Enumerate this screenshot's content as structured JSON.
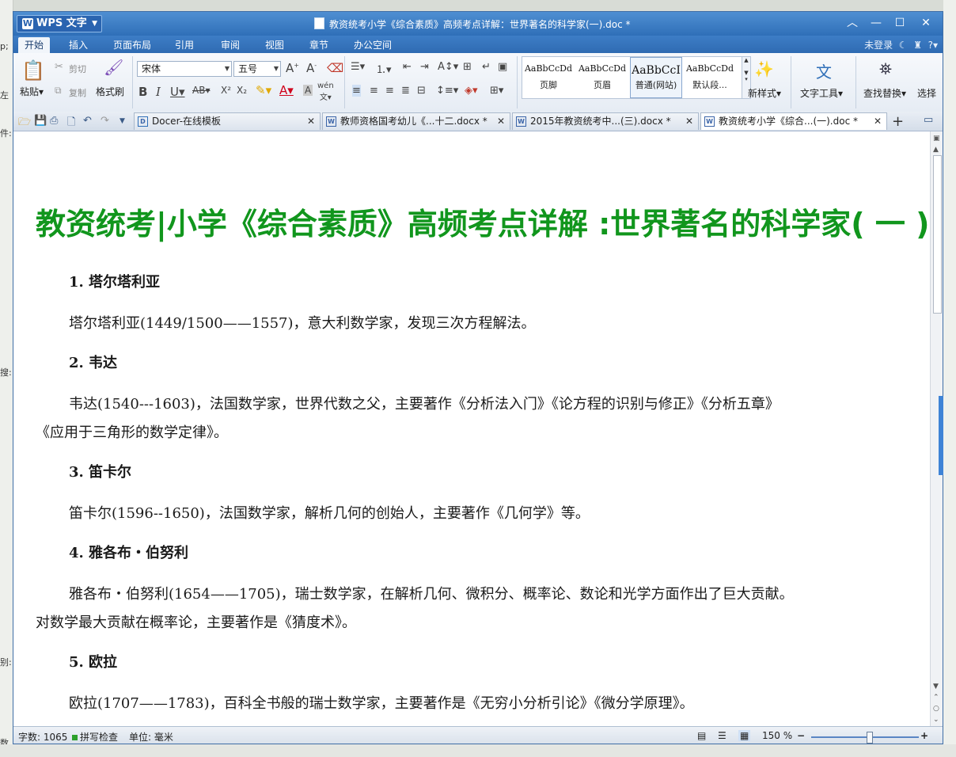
{
  "background": {
    "left_fragments": [
      "p;",
      "左",
      "件:",
      "搜:",
      "别:",
      "数"
    ]
  },
  "window": {
    "app_button": "WPS 文字",
    "title": "教资统考小学《综合素质》高频考点详解：世界著名的科学家(一).doc *"
  },
  "menu": {
    "tabs": [
      "开始",
      "插入",
      "页面布局",
      "引用",
      "审阅",
      "视图",
      "章节",
      "办公空间"
    ],
    "active_tab": "开始",
    "login": "未登录"
  },
  "ribbon": {
    "paste": "粘贴",
    "cut": "剪切",
    "copy": "复制",
    "format_painter": "格式刷",
    "font_name": "宋体",
    "font_size": "五号",
    "styles": [
      {
        "sample": "AaBbCcDd",
        "name": "页脚"
      },
      {
        "sample": "AaBbCcDd",
        "name": "页眉"
      },
      {
        "sample": "AaBbCcI",
        "name": "普通(网站)"
      },
      {
        "sample": "AaBbCcDd",
        "name": "默认段..."
      }
    ],
    "new_style": "新样式",
    "text_tools": "文字工具",
    "find_replace": "查找替换",
    "select": "选择"
  },
  "doc_tabs": [
    {
      "label": "Docer-在线模板",
      "active": false
    },
    {
      "label": "教师资格国考幼儿《...十二.docx *",
      "active": false
    },
    {
      "label": "2015年教资统考中...(三).docx *",
      "active": false
    },
    {
      "label": "教资统考小学《综合...(一).doc *",
      "active": true
    }
  ],
  "document": {
    "title": "教资统考|小学《综合素质》高频考点详解 :世界著名的科学家( 一 )",
    "sections": [
      {
        "heading": "1. 塔尔塔利亚",
        "lines": [
          "塔尔塔利亚(1449/1500——1557)，意大利数学家，发现三次方程解法。"
        ]
      },
      {
        "heading": "2. 韦达",
        "lines": [
          "韦达(1540---1603)，法国数学家，世界代数之父，主要著作《分析法入门》《论方程的识别与修正》《分析五章》",
          "《应用于三角形的数学定律》。"
        ]
      },
      {
        "heading": "3. 笛卡尔",
        "lines": [
          "笛卡尔(1596--1650)，法国数学家，解析几何的创始人，主要著作《几何学》等。"
        ]
      },
      {
        "heading": "4. 雅各布・伯努利",
        "lines": [
          "雅各布・伯努利(1654——1705)，瑞士数学家，在解析几何、微积分、概率论、数论和光学方面作出了巨大贡献。",
          "对数学最大贡献在概率论，主要著作是《猜度术》。"
        ]
      },
      {
        "heading": "5. 欧拉",
        "lines": [
          "欧拉(1707——1783)，百科全书般的瑞士数学家，主要著作是《无穷小分析引论》《微分学原理》。"
        ]
      }
    ]
  },
  "status": {
    "word_count": "字数: 1065",
    "spell_check": "拼写检查",
    "unit": "单位: 毫米",
    "zoom": "150 %"
  },
  "colors": {
    "title_green": "#11961d",
    "titlebar_blue": "#2f6fb8"
  }
}
